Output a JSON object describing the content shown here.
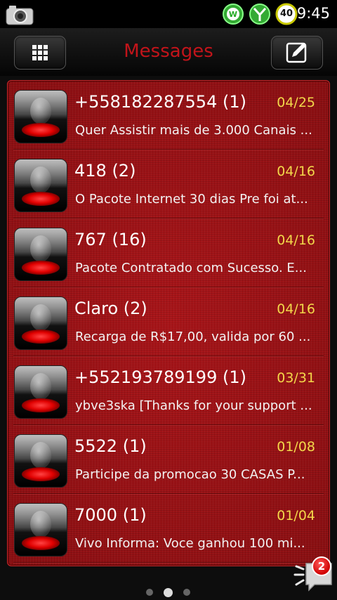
{
  "status_bar": {
    "time": "9:45",
    "battery_level": "40",
    "icons": [
      "camera-icon",
      "whatsapp-notification-icon",
      "signal-antenna-icon",
      "battery-icon"
    ]
  },
  "header": {
    "title": "Messages",
    "left_button_icon": "grid-menu-icon",
    "right_button_icon": "compose-icon"
  },
  "threads": [
    {
      "contact": "+558182287554 (1)",
      "date": "04/25",
      "preview": "Quer Assistir mais de 3.000 Canais ..."
    },
    {
      "contact": "418 (2)",
      "date": "04/16",
      "preview": "O Pacote Internet 30 dias Pre foi at..."
    },
    {
      "contact": "767 (16)",
      "date": "04/16",
      "preview": "Pacote Contratado com Sucesso. E..."
    },
    {
      "contact": "Claro (2)",
      "date": "04/16",
      "preview": "Recarga de R$17,00, valida por 60 ..."
    },
    {
      "contact": "+552193789199 (1)",
      "date": "03/31",
      "preview": "ybve3ska [Thanks for your support ..."
    },
    {
      "contact": "5522 (1)",
      "date": "01/08",
      "preview": "Participe da promocao 30 CASAS P..."
    },
    {
      "contact": "7000 (1)",
      "date": "01/04",
      "preview": "Vivo Informa: Voce ganhou 100 mi..."
    }
  ],
  "pager": {
    "pages": 3,
    "active": 1
  },
  "unread_badge": "2",
  "colors": {
    "accent": "#c2141a",
    "date": "#f3d84a",
    "panel": "#9c1216"
  }
}
